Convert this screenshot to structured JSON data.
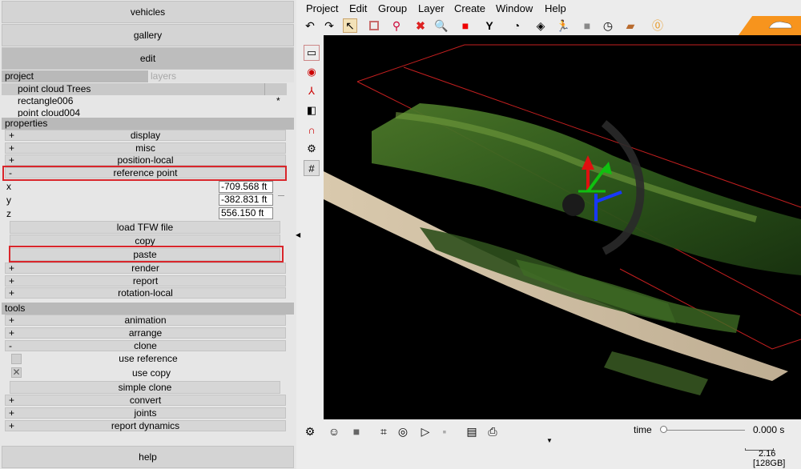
{
  "left_panel": {
    "vehicles_label": "vehicles",
    "gallery_label": "gallery",
    "edit_label": "edit",
    "project_header": "project",
    "layers_header": "layers",
    "project_items": [
      "point cloud Trees",
      "rectangle006",
      "point cloud004"
    ],
    "project_star": "*",
    "properties_header": "properties",
    "prop_sections_top": [
      {
        "sign": "+",
        "label": "display"
      },
      {
        "sign": "+",
        "label": "misc"
      },
      {
        "sign": "+",
        "label": "position-local"
      }
    ],
    "reference_point": {
      "sign": "-",
      "label": "reference point"
    },
    "fields": [
      {
        "label": "x",
        "value": "-709.568 ft"
      },
      {
        "label": "y",
        "value": "-382.831 ft"
      },
      {
        "label": "z",
        "value": "556.150 ft"
      }
    ],
    "load_tfw": "load TFW file",
    "copy": "copy",
    "paste": "paste",
    "prop_sections_bottom": [
      {
        "sign": "+",
        "label": "render"
      },
      {
        "sign": "+",
        "label": "report"
      },
      {
        "sign": "+",
        "label": "rotation-local"
      }
    ],
    "tools_header": "tools",
    "tool_sections": [
      {
        "sign": "+",
        "label": "animation"
      },
      {
        "sign": "+",
        "label": "arrange"
      },
      {
        "sign": "-",
        "label": "clone"
      }
    ],
    "use_reference": "use reference",
    "use_copy": "use copy",
    "simple_clone": "simple clone",
    "tool_sections_bottom": [
      {
        "sign": "+",
        "label": "convert"
      },
      {
        "sign": "+",
        "label": "joints"
      },
      {
        "sign": "+",
        "label": "report dynamics"
      }
    ],
    "help_label": "help"
  },
  "menu": [
    "Project",
    "Edit",
    "Group",
    "Layer",
    "Create",
    "Window",
    "Help"
  ],
  "status": {
    "time_label": "time",
    "time_value": "0.000 s",
    "scale_value": "2.16",
    "memory": "[128GB]"
  },
  "colors": {
    "highlight": "#d9262b",
    "accent": "#f7941d"
  }
}
